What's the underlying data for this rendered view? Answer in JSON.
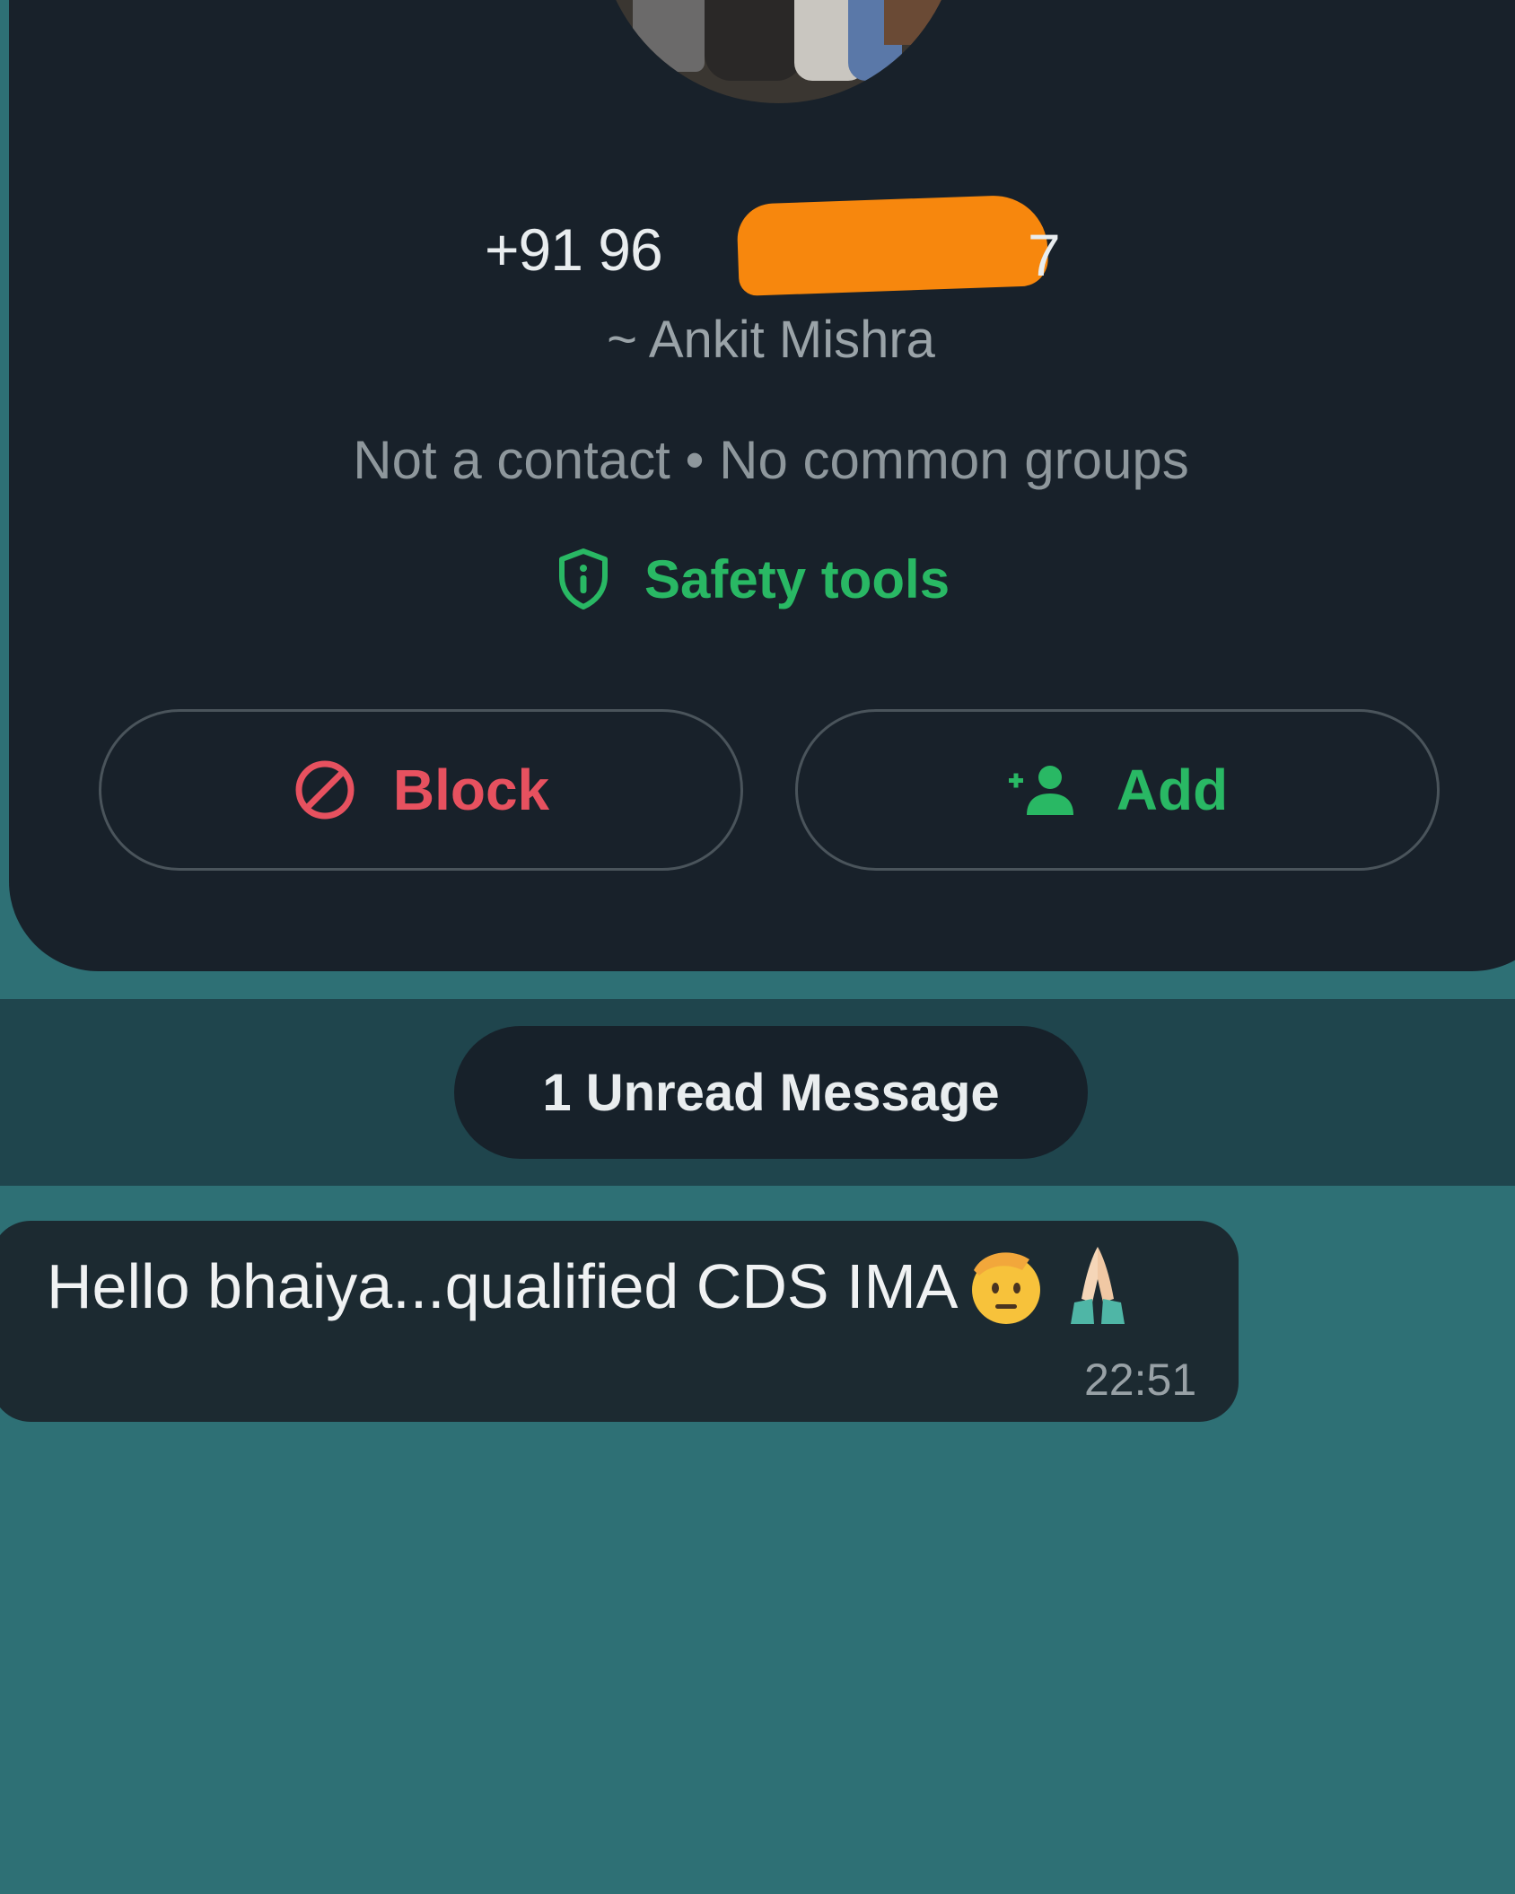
{
  "contact": {
    "phone_visible_prefix": "+91 96",
    "phone_visible_suffix": "7",
    "display_name": "~ Ankit Mishra",
    "meta": "Not a contact • No common groups",
    "safety_label": "Safety tools"
  },
  "actions": {
    "block_label": "Block",
    "add_label": "Add"
  },
  "banner": {
    "unread_label": "1 Unread Message"
  },
  "message": {
    "text": "Hello bhaiya...qualified CDS IMA",
    "emojis": [
      "saluting-face",
      "folded-hands"
    ],
    "time": "22:51"
  },
  "colors": {
    "chat_background": "#2e7075",
    "card_background": "#18212a",
    "accent_green": "#29b864",
    "block_red": "#e7515f",
    "redaction_orange": "#f7870d"
  }
}
